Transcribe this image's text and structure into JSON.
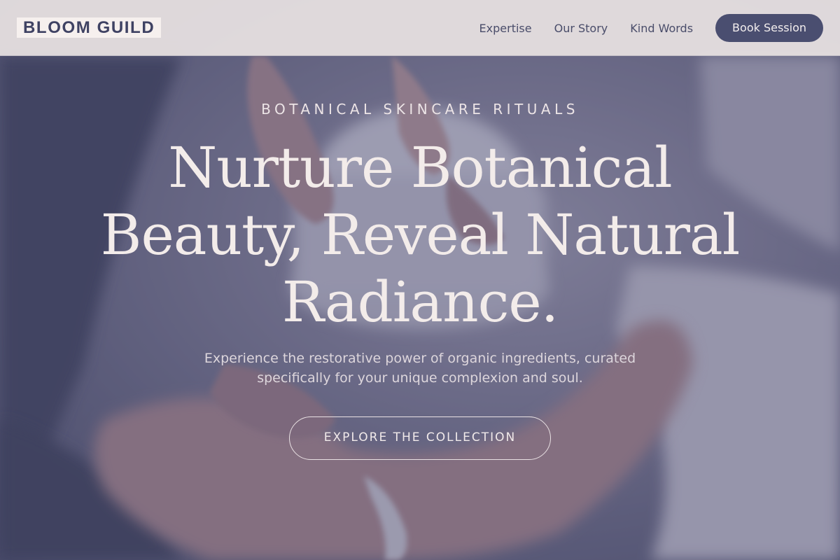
{
  "header": {
    "logo_text": "BLOOM GUILD",
    "nav_items": [
      {
        "label": "Expertise"
      },
      {
        "label": "Our Story"
      },
      {
        "label": "Kind Words"
      }
    ],
    "cta_label": "Book Session"
  },
  "hero": {
    "eyebrow": "BOTANICAL SKINCARE RITUALS",
    "headline_lines": [
      "Nurture Botanical",
      "Beauty, Reveal Natural",
      "Radiance."
    ],
    "subtitle_lines": [
      "Experience the restorative power of organic ingredients, curated",
      "specifically for your unique complexion and soul."
    ],
    "cta_label": "EXPLORE THE COLLECTION",
    "background_image": "hands-holding-cream-jar-photo"
  },
  "colors": {
    "brand_dark": "#4a4e70",
    "header_bg": "#e8e2e2",
    "hero_text": "#f3ecea",
    "overlay": "#484a6c"
  }
}
